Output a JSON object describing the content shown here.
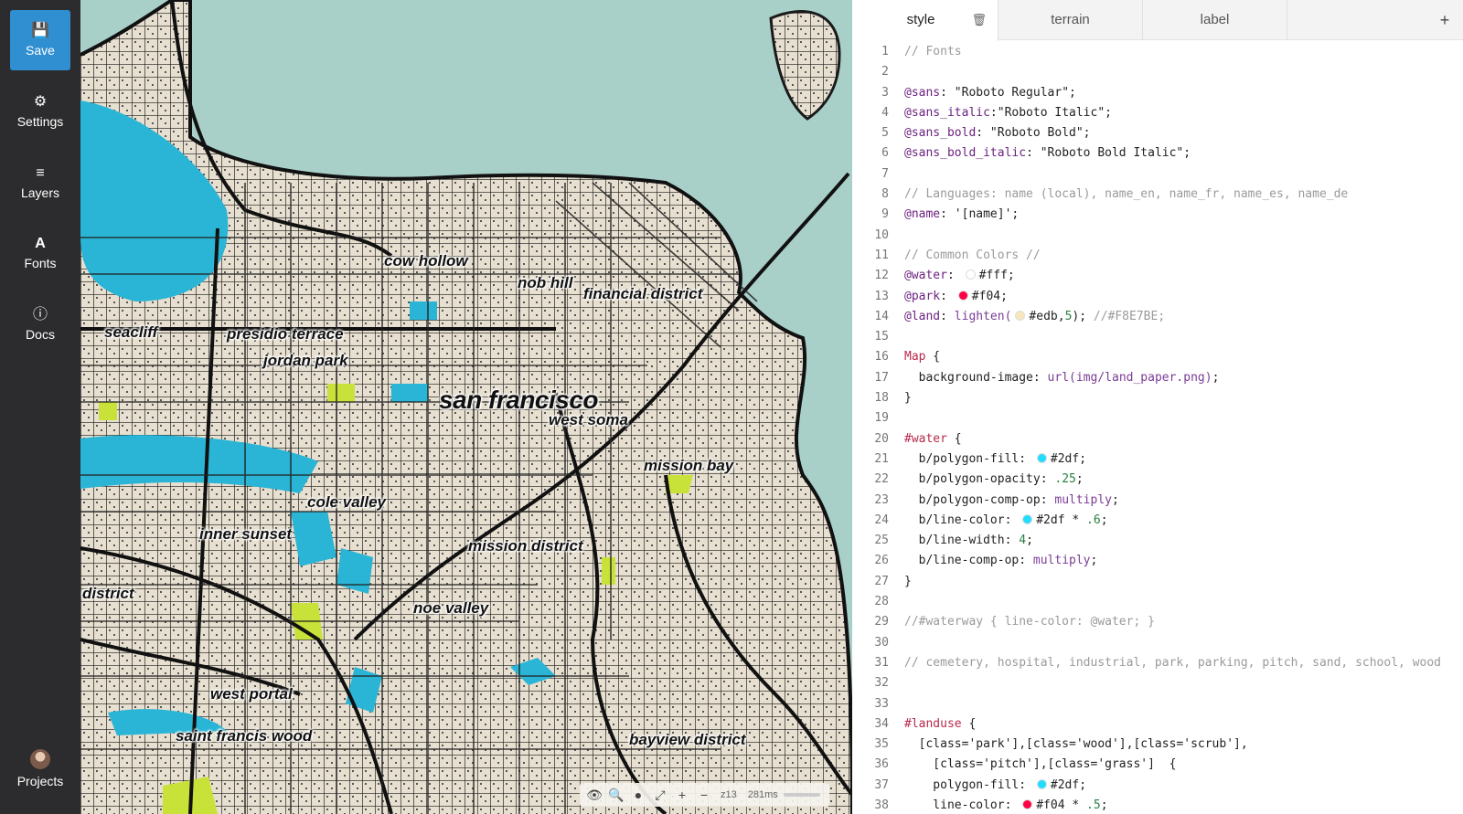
{
  "sidebar": {
    "items": [
      {
        "label": "Save",
        "icon": "save-icon"
      },
      {
        "label": "Settings",
        "icon": "gear-icon"
      },
      {
        "label": "Layers",
        "icon": "layers-icon"
      },
      {
        "label": "Fonts",
        "icon": "font-icon"
      },
      {
        "label": "Docs",
        "icon": "info-icon"
      }
    ],
    "projects_label": "Projects"
  },
  "map": {
    "labels": [
      {
        "text": "cow hollow"
      },
      {
        "text": "nob hill"
      },
      {
        "text": "financial district"
      },
      {
        "text": "seacliff"
      },
      {
        "text": "presidio terrace"
      },
      {
        "text": "jordan park"
      },
      {
        "text": "san francisco"
      },
      {
        "text": "west soma"
      },
      {
        "text": "mission bay"
      },
      {
        "text": "cole valley"
      },
      {
        "text": "inner sunset"
      },
      {
        "text": "mission district"
      },
      {
        "text": "district"
      },
      {
        "text": "noe valley"
      },
      {
        "text": "west portal"
      },
      {
        "text": "saint francis wood"
      },
      {
        "text": "bayview district"
      }
    ],
    "toolbar": {
      "zoom": "z13",
      "render_time": "281ms"
    },
    "colors": {
      "water": "#a9cfc9",
      "land": "#e7dfcf",
      "park": "#2ab5d6",
      "green": "#c8e23a"
    }
  },
  "editor": {
    "tabs": [
      {
        "label": "style"
      },
      {
        "label": "terrain"
      },
      {
        "label": "label"
      }
    ],
    "lines": [
      [
        {
          "t": "// Fonts",
          "c": "comment"
        }
      ],
      [],
      [
        {
          "t": "@sans",
          "c": "var"
        },
        {
          "t": ": \"Roboto Regular\";",
          "c": "str"
        }
      ],
      [
        {
          "t": "@sans_italic",
          "c": "var"
        },
        {
          "t": ":\"Roboto Italic\";",
          "c": "str"
        }
      ],
      [
        {
          "t": "@sans_bold",
          "c": "var"
        },
        {
          "t": ": \"Roboto Bold\";",
          "c": "str"
        }
      ],
      [
        {
          "t": "@sans_bold_italic",
          "c": "var"
        },
        {
          "t": ": \"Roboto Bold Italic\";",
          "c": "str"
        }
      ],
      [],
      [
        {
          "t": "// Languages: name (local), name_en, name_fr, name_es, name_de",
          "c": "comment"
        }
      ],
      [
        {
          "t": "@name",
          "c": "var"
        },
        {
          "t": ": '[name]';",
          "c": "str"
        }
      ],
      [],
      [
        {
          "t": "// Common Colors //",
          "c": "comment"
        }
      ],
      [
        {
          "t": "@water",
          "c": "var"
        },
        {
          "t": ": ",
          "c": "str"
        },
        {
          "sw": "#ffffff"
        },
        {
          "t": "#fff;",
          "c": "str"
        }
      ],
      [
        {
          "t": "@park",
          "c": "var"
        },
        {
          "t": ": ",
          "c": "str"
        },
        {
          "sw": "#ff0044"
        },
        {
          "t": "#f04;",
          "c": "str"
        }
      ],
      [
        {
          "t": "@land",
          "c": "var"
        },
        {
          "t": ": ",
          "c": "str"
        },
        {
          "t": "lighten(",
          "c": "fn"
        },
        {
          "sw": "#f8e7be"
        },
        {
          "t": "#edb,",
          "c": "str"
        },
        {
          "t": "5",
          "c": "num"
        },
        {
          "t": "); ",
          "c": "str"
        },
        {
          "t": "//#F8E7BE;",
          "c": "comment"
        }
      ],
      [],
      [
        {
          "t": "Map",
          "c": "sel"
        },
        {
          "t": " {",
          "c": "str"
        }
      ],
      [
        {
          "t": "  background-image: ",
          "c": "str"
        },
        {
          "t": "url(img/land_paper.png)",
          "c": "fn"
        },
        {
          "t": ";",
          "c": "str"
        }
      ],
      [
        {
          "t": "}",
          "c": "str"
        }
      ],
      [],
      [
        {
          "t": "#water",
          "c": "sel"
        },
        {
          "t": " {",
          "c": "str"
        }
      ],
      [
        {
          "t": "  b/polygon-fill: ",
          "c": "str"
        },
        {
          "sw": "#22ddff"
        },
        {
          "t": "#2df;",
          "c": "str"
        }
      ],
      [
        {
          "t": "  b/polygon-opacity: ",
          "c": "str"
        },
        {
          "t": ".25",
          "c": "num"
        },
        {
          "t": ";",
          "c": "str"
        }
      ],
      [
        {
          "t": "  b/polygon-comp-op: ",
          "c": "str"
        },
        {
          "t": "multiply",
          "c": "fn"
        },
        {
          "t": ";",
          "c": "str"
        }
      ],
      [
        {
          "t": "  b/line-color: ",
          "c": "str"
        },
        {
          "sw": "#22ddff"
        },
        {
          "t": "#2df * ",
          "c": "str"
        },
        {
          "t": ".6",
          "c": "num"
        },
        {
          "t": ";",
          "c": "str"
        }
      ],
      [
        {
          "t": "  b/line-width: ",
          "c": "str"
        },
        {
          "t": "4",
          "c": "num"
        },
        {
          "t": ";",
          "c": "str"
        }
      ],
      [
        {
          "t": "  b/line-comp-op: ",
          "c": "str"
        },
        {
          "t": "multiply",
          "c": "fn"
        },
        {
          "t": ";",
          "c": "str"
        }
      ],
      [
        {
          "t": "}",
          "c": "str"
        }
      ],
      [],
      [
        {
          "t": "//#waterway { line-color: @water; }",
          "c": "comment"
        }
      ],
      [],
      [
        {
          "t": "// cemetery, hospital, industrial, park, parking, pitch, sand, school, wood",
          "c": "comment"
        }
      ],
      [],
      [],
      [
        {
          "t": "#landuse",
          "c": "sel"
        },
        {
          "t": " {",
          "c": "str"
        }
      ],
      [
        {
          "t": "  [class='park'],[class='wood'],[class='scrub'],",
          "c": "str"
        }
      ],
      [
        {
          "t": "    [class='pitch'],[class='grass']  {",
          "c": "str"
        }
      ],
      [
        {
          "t": "    polygon-fill: ",
          "c": "str"
        },
        {
          "sw": "#22ddff"
        },
        {
          "t": "#2df;",
          "c": "str"
        }
      ],
      [
        {
          "t": "    line-color: ",
          "c": "str"
        },
        {
          "sw": "#ff0044"
        },
        {
          "t": "#f04 * ",
          "c": "str"
        },
        {
          "t": ".5",
          "c": "num"
        },
        {
          "t": ";",
          "c": "str"
        }
      ]
    ]
  }
}
